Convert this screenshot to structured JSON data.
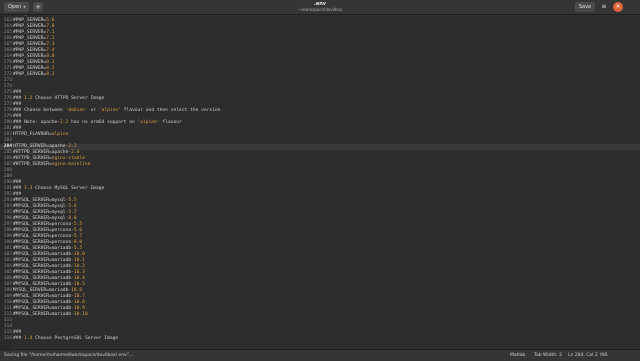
{
  "header": {
    "open_label": "Open",
    "open_arrow": "▾",
    "new_tab_label": "+",
    "title": ".env",
    "subtitle": "~/workspace/devilbox",
    "save_label": "Save",
    "menu_label": "≡",
    "close_label": "×"
  },
  "editor": {
    "current_line": 284,
    "lines": [
      {
        "n": "262",
        "text": "#PHP_SERVER=5.5"
      },
      {
        "n": "263",
        "text": "#PHP_SERVER=5.6"
      },
      {
        "n": "264",
        "text": "#PHP_SERVER=7.0"
      },
      {
        "n": "265",
        "text": "#PHP_SERVER=7.1"
      },
      {
        "n": "266",
        "text": "#PHP_SERVER=7.2"
      },
      {
        "n": "267",
        "text": "#PHP_SERVER=7.3"
      },
      {
        "n": "268",
        "text": "#PHP_SERVER=7.4"
      },
      {
        "n": "269",
        "text": "#PHP_SERVER=8.0"
      },
      {
        "n": "270",
        "text": "#PHP_SERVER=8.1"
      },
      {
        "n": "271",
        "text": "#PHP_SERVER=8.2"
      },
      {
        "n": "272",
        "text": "#PHP_SERVER=8.3"
      },
      {
        "n": "273",
        "text": ""
      },
      {
        "n": "274",
        "text": ""
      },
      {
        "n": "275",
        "text": "###"
      },
      {
        "n": "276",
        "text": "### 1.2 Choose HTTPD Server Image"
      },
      {
        "n": "277",
        "text": "###"
      },
      {
        "n": "278",
        "text": "### Choose between 'debian' or 'alpine' flavour and then select the version"
      },
      {
        "n": "279",
        "text": "###"
      },
      {
        "n": "280",
        "text": "### Note: apache-2.2 has no arm64 support on 'alpine' flavour"
      },
      {
        "n": "281",
        "text": "###"
      },
      {
        "n": "282",
        "text": "HTTPD_FLAVOUR=alpine"
      },
      {
        "n": "283",
        "text": ""
      },
      {
        "n": "284",
        "text": "HTTPD_SERVER=apache-2.2"
      },
      {
        "n": "285",
        "text": "#HTTPD_SERVER=apache-2.4"
      },
      {
        "n": "286",
        "text": "#HTTPD_SERVER=nginx-stable"
      },
      {
        "n": "287",
        "text": "#HTTPD_SERVER=nginx-mainline"
      },
      {
        "n": "288",
        "text": ""
      },
      {
        "n": "289",
        "text": ""
      },
      {
        "n": "290",
        "text": "###"
      },
      {
        "n": "291",
        "text": "### 1.3 Choose MySQL Server Image"
      },
      {
        "n": "292",
        "text": "###"
      },
      {
        "n": "293",
        "text": "#MYSQL_SERVER=mysql-5.5"
      },
      {
        "n": "294",
        "text": "#MYSQL_SERVER=mysql-5.6"
      },
      {
        "n": "295",
        "text": "#MYSQL_SERVER=mysql-5.7"
      },
      {
        "n": "296",
        "text": "#MYSQL_SERVER=mysql-8.0"
      },
      {
        "n": "297",
        "text": "#MYSQL_SERVER=percona-5.5"
      },
      {
        "n": "298",
        "text": "#MYSQL_SERVER=percona-5.6"
      },
      {
        "n": "299",
        "text": "#MYSQL_SERVER=percona-5.7"
      },
      {
        "n": "300",
        "text": "#MYSQL_SERVER=percona-8.0"
      },
      {
        "n": "301",
        "text": "#MYSQL_SERVER=mariadb-5.5"
      },
      {
        "n": "302",
        "text": "#MYSQL_SERVER=mariadb-10.0"
      },
      {
        "n": "303",
        "text": "#MYSQL_SERVER=mariadb-10.1"
      },
      {
        "n": "304",
        "text": "#MYSQL_SERVER=mariadb-10.2"
      },
      {
        "n": "305",
        "text": "#MYSQL_SERVER=mariadb-10.3"
      },
      {
        "n": "306",
        "text": "#MYSQL_SERVER=mariadb-10.4"
      },
      {
        "n": "307",
        "text": "#MYSQL_SERVER=mariadb-10.5"
      },
      {
        "n": "308",
        "text": "MYSQL_SERVER=mariadb-10.6"
      },
      {
        "n": "309",
        "text": "#MYSQL_SERVER=mariadb-10.7"
      },
      {
        "n": "310",
        "text": "#MYSQL_SERVER=mariadb-10.8"
      },
      {
        "n": "311",
        "text": "#MYSQL_SERVER=mariadb-10.9"
      },
      {
        "n": "312",
        "text": "#MYSQL_SERVER=mariadb-10.10"
      },
      {
        "n": "313",
        "text": ""
      },
      {
        "n": "314",
        "text": ""
      },
      {
        "n": "315",
        "text": "###"
      },
      {
        "n": "316",
        "text": "### 1.4 Choose PostgreSQL Server Image"
      }
    ]
  },
  "status": {
    "message": "Saving file \"/home/mohamed/workspace/devilbox/.env\"...",
    "language": "Matlab",
    "tab_width": "Tab Width: 2",
    "position": "Ln 284, Col 2",
    "mode": "INS"
  },
  "colors": {
    "value": "#e0a040",
    "close_button": "#e0653a"
  }
}
